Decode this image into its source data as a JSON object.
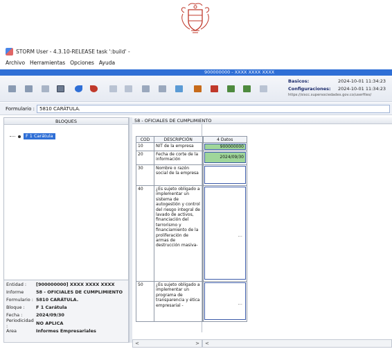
{
  "window": {
    "title": "STORM User - 4.3.10-RELEASE task ':build' -"
  },
  "menu": [
    "Archivo",
    "Herramientas",
    "Opciones",
    "Ayuda"
  ],
  "header_bar": {
    "title": "900000000 - XXXX XXXX XXXX"
  },
  "info": {
    "basicos_label": "Basicos:",
    "basicos_value": "2024-10-01 11:34:23",
    "config_label": "Configuraciones:",
    "config_value": "2024-10-01 11:34:23",
    "url": "https://siscc.supersociedades.gov.co/userfiles/"
  },
  "formulario": {
    "label": "Formulario :",
    "value": "5810 CARÁTULA."
  },
  "left_panel": {
    "header": "BLOQUES",
    "tree_item": "F 1 Carátula"
  },
  "entity_info": [
    {
      "key": "Entidad :",
      "value": "[900000000] XXXX XXXX XXXX"
    },
    {
      "key": "Informe",
      "value": "58 - OFICIALES DE CUMPLIMIENTO"
    },
    {
      "key": "Formulario :",
      "value": "5810 CARÁTULA."
    },
    {
      "key": "Bloque :",
      "value": "F 1 Carátula"
    },
    {
      "key": "Fecha :",
      "value": "2024/09/30"
    },
    {
      "key": "Periodicidad :",
      "value": "NO APLICA"
    },
    {
      "key": "Area",
      "value": "Informes Empresariales"
    }
  ],
  "right_panel": {
    "header": "58 - OFICIALES DE CUMPLIMIENTO"
  },
  "table": {
    "headers": {
      "cod": "COD",
      "desc": "DESCRIPCIÓN",
      "dato": "4 Datos"
    },
    "rows": [
      {
        "cod": "10",
        "desc": "NIT de la empresa",
        "value": "900000000"
      },
      {
        "cod": "20",
        "desc": "Fecha de corte de la información",
        "value": "2024/09/30"
      },
      {
        "cod": "30",
        "desc": "Nombre o razón social de la empresa",
        "value": ""
      },
      {
        "cod": "40",
        "desc": "¿Es sujeto obligado a implementar un sistema de autogestión y control del riesgo integral de lavado de activos, financiación del terrorismo y financiamiento de la proliferación de armas de destrucción masiva-",
        "value": "..."
      },
      {
        "cod": "50",
        "desc": "¿Es sujeto obligado a implementar un programa de transparencia y ética empresarial -",
        "value": "..."
      }
    ]
  },
  "scroll": {
    "left": "<",
    "right": ">"
  }
}
